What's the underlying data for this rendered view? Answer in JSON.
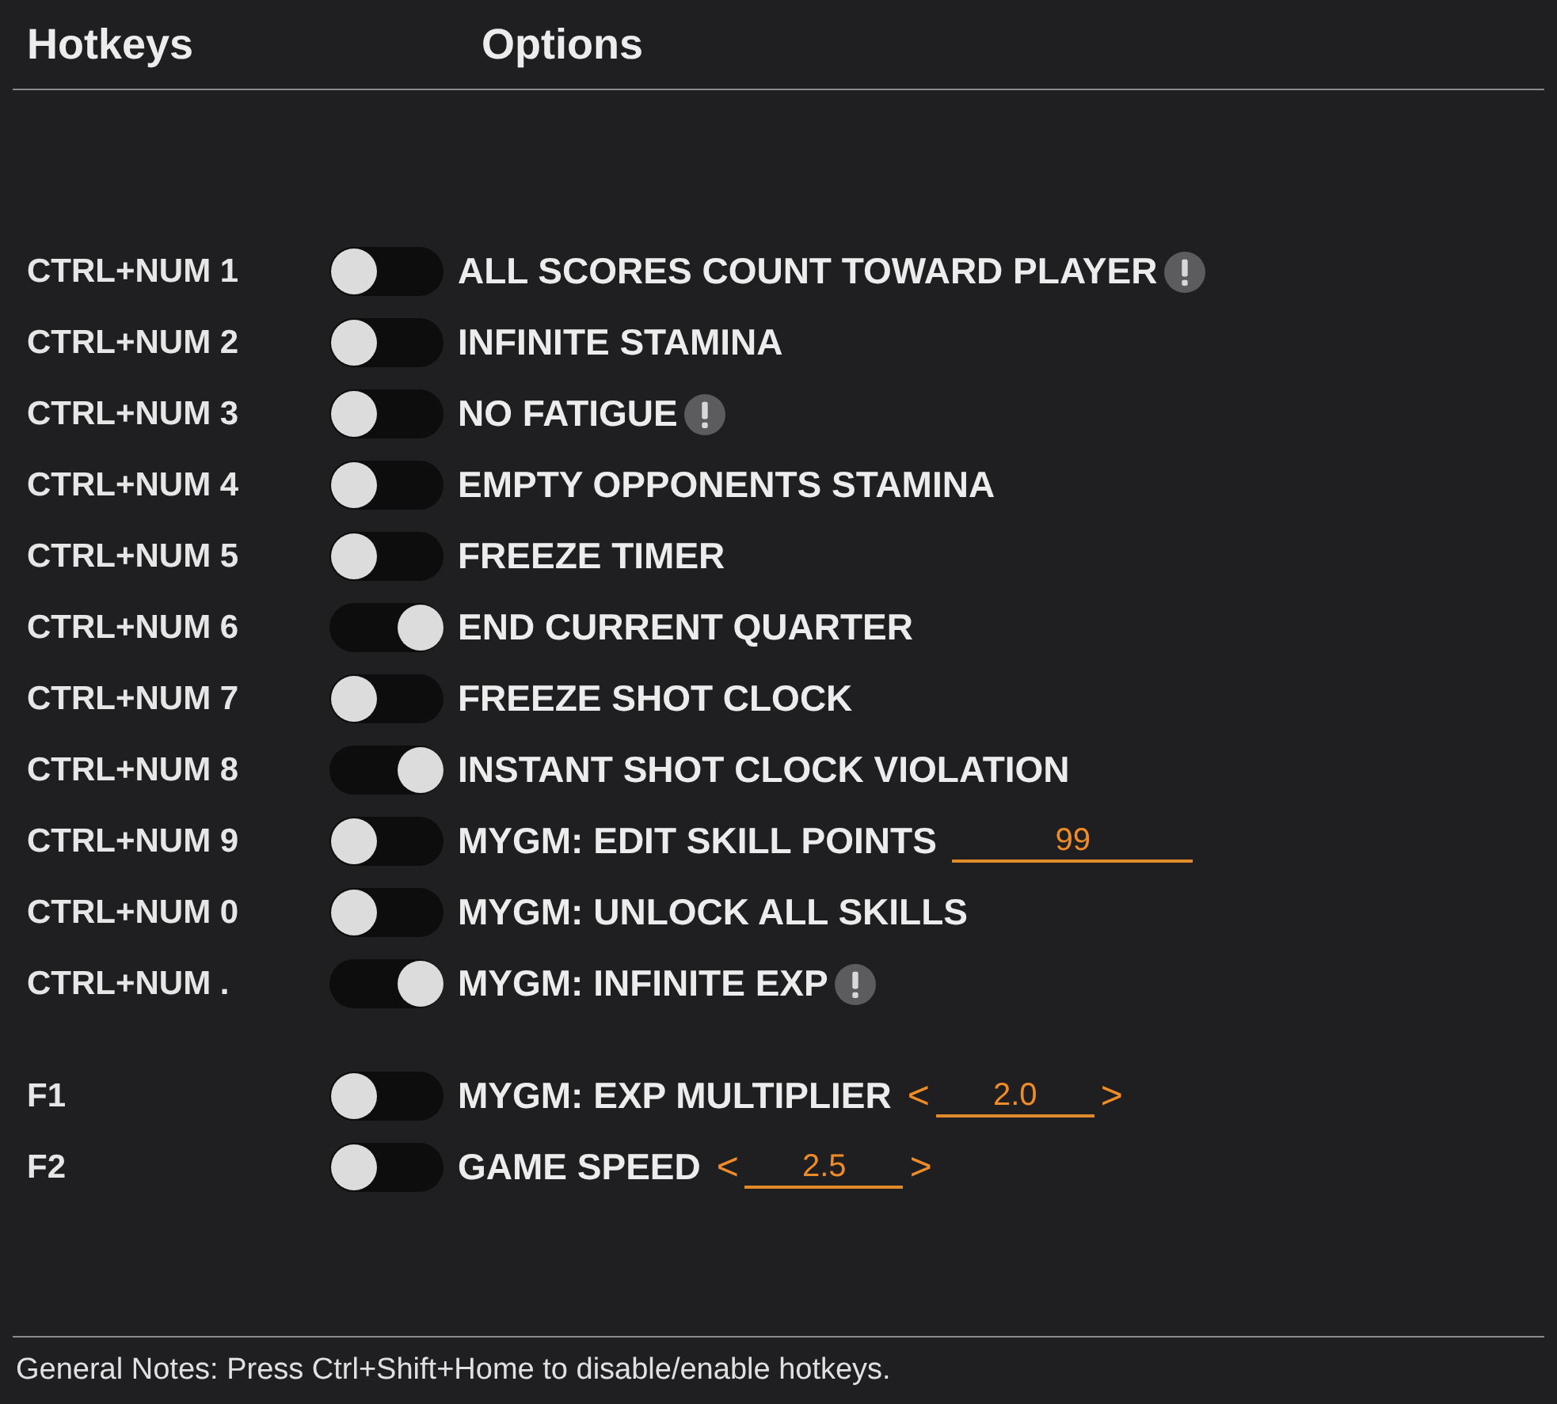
{
  "header": {
    "hotkeys_title": "Hotkeys",
    "options_title": "Options"
  },
  "groups": [
    {
      "rows": [
        {
          "hotkey": "CTRL+NUM 1",
          "on": false,
          "label": "ALL SCORES COUNT TOWARD PLAYER",
          "info": true,
          "kind": "plain"
        },
        {
          "hotkey": "CTRL+NUM 2",
          "on": false,
          "label": "INFINITE STAMINA",
          "info": false,
          "kind": "plain"
        },
        {
          "hotkey": "CTRL+NUM 3",
          "on": false,
          "label": "NO FATIGUE",
          "info": true,
          "kind": "plain"
        },
        {
          "hotkey": "CTRL+NUM 4",
          "on": false,
          "label": "EMPTY OPPONENTS STAMINA",
          "info": false,
          "kind": "plain"
        },
        {
          "hotkey": "CTRL+NUM 5",
          "on": false,
          "label": "FREEZE TIMER",
          "info": false,
          "kind": "plain"
        },
        {
          "hotkey": "CTRL+NUM 6",
          "on": true,
          "label": "END CURRENT QUARTER",
          "info": false,
          "kind": "plain"
        },
        {
          "hotkey": "CTRL+NUM 7",
          "on": false,
          "label": "FREEZE SHOT CLOCK",
          "info": false,
          "kind": "plain"
        },
        {
          "hotkey": "CTRL+NUM 8",
          "on": true,
          "label": "INSTANT SHOT CLOCK VIOLATION",
          "info": false,
          "kind": "plain"
        },
        {
          "hotkey": "CTRL+NUM 9",
          "on": false,
          "label": "MYGM: EDIT SKILL POINTS",
          "info": false,
          "kind": "input",
          "value": "99"
        },
        {
          "hotkey": "CTRL+NUM 0",
          "on": false,
          "label": "MYGM: UNLOCK ALL SKILLS",
          "info": false,
          "kind": "plain"
        },
        {
          "hotkey": "CTRL+NUM .",
          "on": true,
          "label": "MYGM: INFINITE EXP",
          "info": true,
          "kind": "plain"
        }
      ]
    },
    {
      "rows": [
        {
          "hotkey": "F1",
          "on": false,
          "label": "MYGM: EXP MULTIPLIER",
          "info": false,
          "kind": "stepper",
          "prev": "<",
          "value": "2.0",
          "next": ">"
        },
        {
          "hotkey": "F2",
          "on": false,
          "label": "GAME SPEED",
          "info": false,
          "kind": "stepper",
          "prev": "<",
          "value": "2.5",
          "next": ">"
        }
      ]
    }
  ],
  "footer": {
    "notes": "General Notes: Press Ctrl+Shift+Home to disable/enable hotkeys."
  }
}
